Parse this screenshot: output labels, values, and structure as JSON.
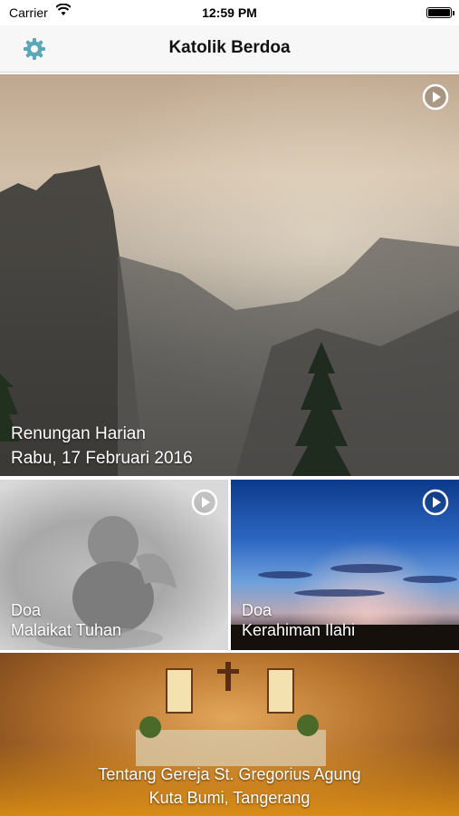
{
  "status_bar": {
    "carrier": "Carrier",
    "time": "12:59 PM"
  },
  "navbar": {
    "title": "Katolik Berdoa",
    "settings_icon": "gear-icon",
    "accent": "#5aa7b8"
  },
  "hero": {
    "line1": "Renungan Harian",
    "line2": "Rabu, 17 Februari 2016",
    "icon": "play-icon"
  },
  "tiles": [
    {
      "line1": "Doa",
      "line2": "Malaikat Tuhan",
      "icon": "play-icon"
    },
    {
      "line1": "Doa",
      "line2": "Kerahiman Ilahi",
      "icon": "play-icon"
    }
  ],
  "bottom": {
    "line1": "Tentang Gereja St. Gregorius Agung",
    "line2": "Kuta Bumi, Tangerang"
  }
}
